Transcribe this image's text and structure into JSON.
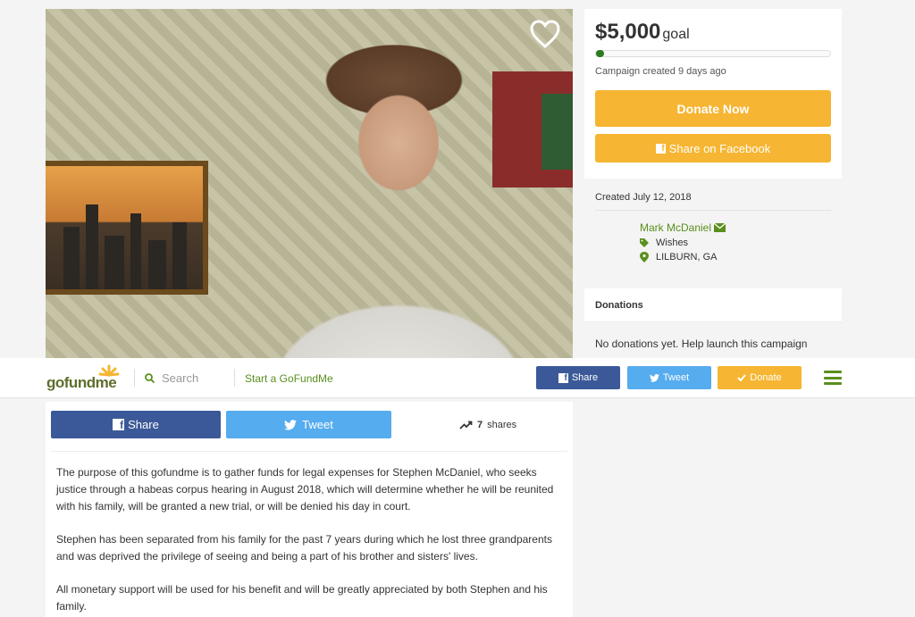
{
  "campaign": {
    "goal_amount": "$5,000",
    "goal_word": "goal",
    "progress_fraction": 0.0,
    "created_ago": "Campaign created 9 days ago",
    "donate_now": "Donate Now",
    "share_facebook": "Share on Facebook",
    "created_date": "Created July 12, 2018"
  },
  "organizer": {
    "name": "Mark McDaniel",
    "category": "Wishes",
    "location": "LILBURN, GA"
  },
  "donations": {
    "title": "Donations",
    "empty_text": "No donations yet. Help launch this campaign"
  },
  "nav": {
    "logo": "gofundme",
    "search_placeholder": "Search",
    "start": "Start a GoFundMe",
    "share": "Share",
    "tweet": "Tweet",
    "donate": "Donate"
  },
  "story": {
    "share": "Share",
    "tweet": "Tweet",
    "shares_count": "7",
    "shares_word": "shares",
    "paragraphs": [
      "The purpose of this gofundme  is to gather funds for legal expenses for Stephen McDaniel, who seeks justice through a habeas corpus hearing  in August 2018, which will determine whether he will be reunited with his family, will be granted a new trial, or will be denied his day in court.",
      "Stephen has been separated from his family for the past 7 years during which he lost three grandparents and was deprived the privilege of seeing and being a part of his brother and sisters'  lives.",
      "All monetary support will be used for his benefit and will be greatly appreciated by both Stephen and his family."
    ]
  },
  "colors": {
    "accent": "#f6b532",
    "facebook": "#3b5998",
    "twitter": "#55acee",
    "brand_green": "#5a8f1d",
    "progress": "#2c7b1f"
  },
  "icons": [
    "heart-icon",
    "facebook-icon",
    "twitter-icon",
    "search-icon",
    "envelope-icon",
    "tag-icon",
    "map-pin-icon",
    "trending-icon",
    "check-icon",
    "menu-icon"
  ]
}
